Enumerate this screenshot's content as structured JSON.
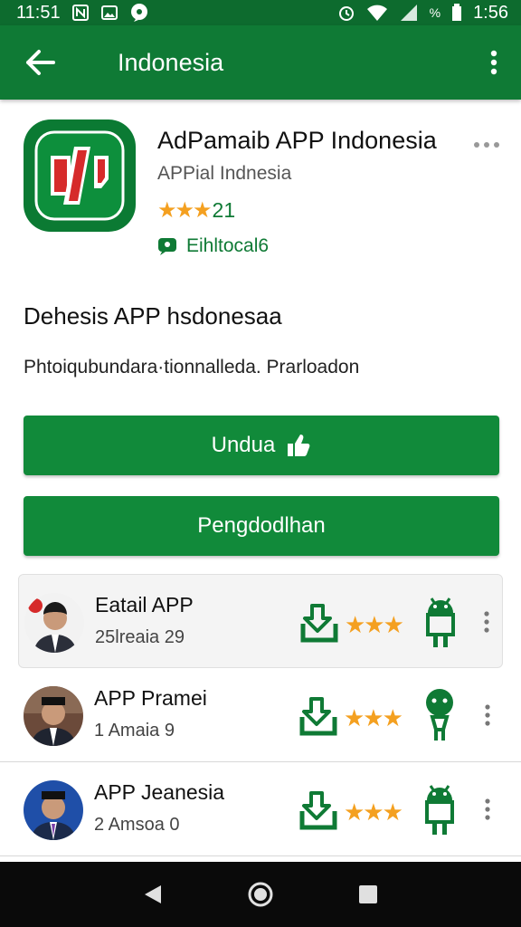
{
  "status_bar": {
    "time_left": "11:51",
    "battery": "%",
    "time_right": "1:56"
  },
  "app_bar": {
    "title": "Indonesia"
  },
  "header": {
    "app_name": "AdPamaib APP Indonesia",
    "subtitle": "APPial Indnesia",
    "stars": "★★★",
    "rating": "21",
    "badge": "Eihltocal6"
  },
  "description": {
    "title": "Dehesis APP hsdonesaa",
    "text": "Phtoiqubundara·tionnalleda. Prarloadon"
  },
  "buttons": {
    "primary_label": "Undua",
    "secondary_label": "Pengdodlhan"
  },
  "list": [
    {
      "title": "Eatail APP",
      "subtitle": "25lreaia 29",
      "stars": "★★★"
    },
    {
      "title": "APP Pramei",
      "subtitle": "1 Amaia 9",
      "stars": "★★★"
    },
    {
      "title": "APP Jeanesia",
      "subtitle": "2 Amsoa 0",
      "stars": "★★★"
    }
  ],
  "colors": {
    "brand_green": "#0f7a35",
    "star": "#f4a020",
    "accent_red": "#d62b2b"
  }
}
